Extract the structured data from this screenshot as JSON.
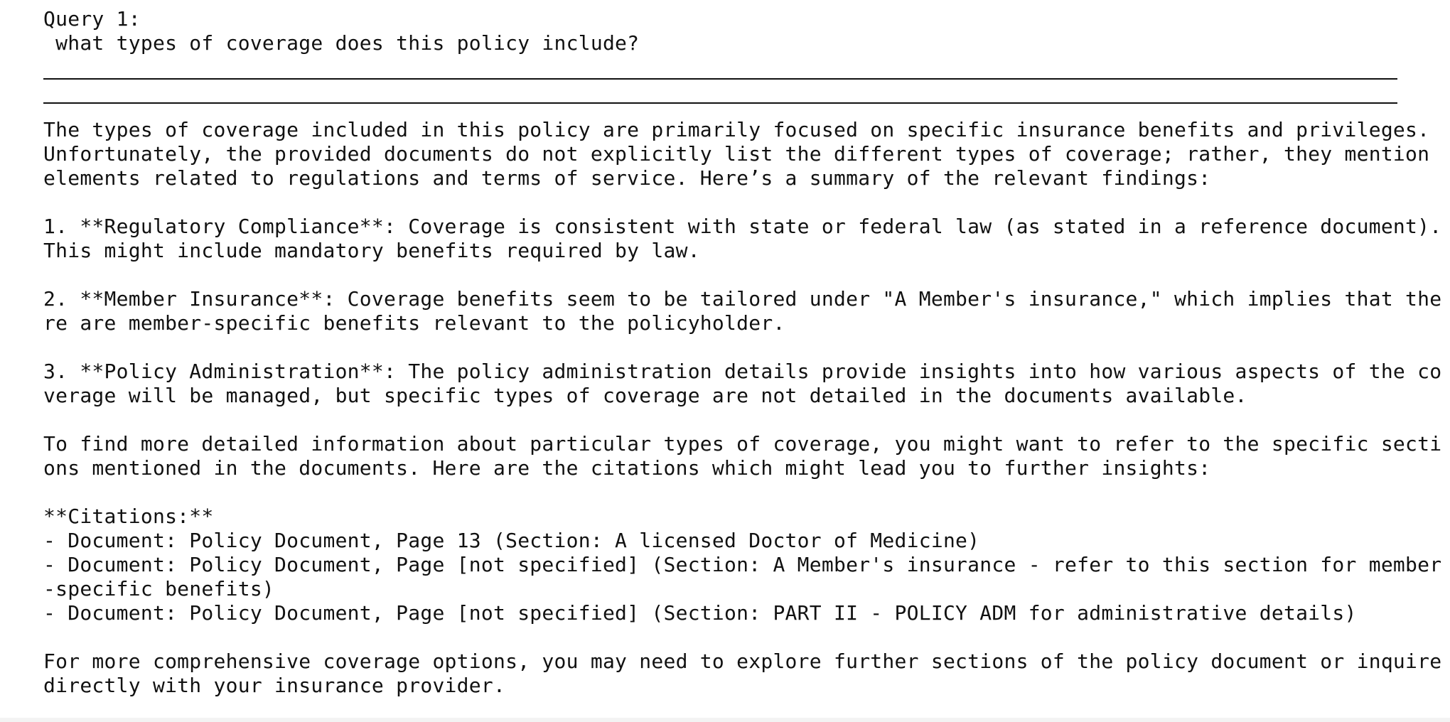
{
  "query": {
    "label": "Query 1:",
    "text": " what types of coverage does this policy include?"
  },
  "answer": {
    "lines": [
      "The types of coverage included in this policy are primarily focused on specific insurance benefits and privileges.",
      "Unfortunately, the provided documents do not explicitly list the different types of coverage; rather, they mention",
      "elements related to regulations and terms of service. Here’s a summary of the relevant findings:",
      "",
      "1. **Regulatory Compliance**: Coverage is consistent with state or federal law (as stated in a reference document).",
      "This might include mandatory benefits required by law.",
      "",
      "2. **Member Insurance**: Coverage benefits seem to be tailored under \"A Member's insurance,\" which implies that the",
      "re are member-specific benefits relevant to the policyholder.",
      "",
      "3. **Policy Administration**: The policy administration details provide insights into how various aspects of the co",
      "verage will be managed, but specific types of coverage are not detailed in the documents available.",
      "",
      "To find more detailed information about particular types of coverage, you might want to refer to the specific secti",
      "ons mentioned in the documents. Here are the citations which might lead you to further insights:",
      "",
      "**Citations:**",
      "- Document: Policy Document, Page 13 (Section: A licensed Doctor of Medicine)",
      "- Document: Policy Document, Page [not specified] (Section: A Member's insurance - refer to this section for member",
      "-specific benefits)",
      "- Document: Policy Document, Page [not specified] (Section: PART II - POLICY ADM for administrative details)",
      "",
      "For more comprehensive coverage options, you may need to explore further sections of the policy document or inquire",
      "directly with your insurance provider."
    ]
  }
}
